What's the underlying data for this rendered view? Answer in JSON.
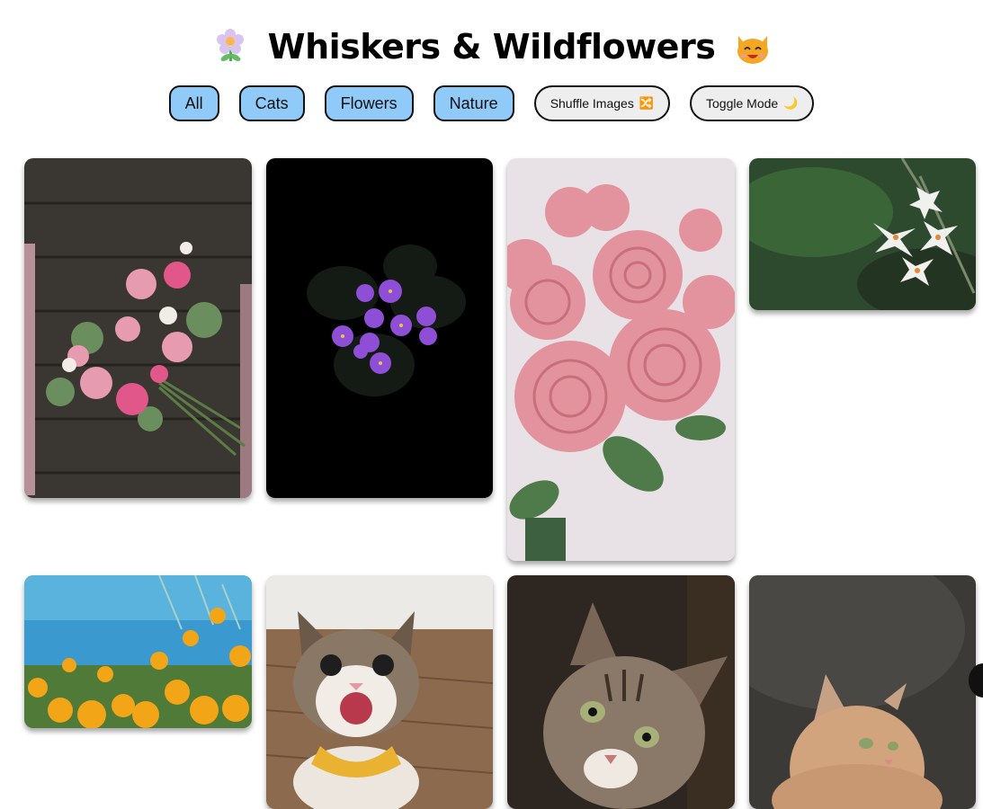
{
  "header": {
    "title": "Whiskers & Wildflowers",
    "icon_left": "flower-icon",
    "icon_right": "cat-icon"
  },
  "filters": {
    "all_label": "All",
    "cats_label": "Cats",
    "flowers_label": "Flowers",
    "nature_label": "Nature",
    "shuffle_label": "Shuffle Images",
    "shuffle_icon": "🔀",
    "toggle_label": "Toggle Mode",
    "toggle_icon": "🌙"
  },
  "colors": {
    "filter_bg": "#90caf9",
    "pill_bg": "#eeeeee",
    "border": "#111111"
  },
  "gallery": {
    "images": [
      {
        "name": "bouquet-on-wood",
        "category": "flowers"
      },
      {
        "name": "violets-dark",
        "category": "flowers"
      },
      {
        "name": "pink-peonies",
        "category": "flowers"
      },
      {
        "name": "white-blossom",
        "category": "nature"
      },
      {
        "name": "orange-poppies",
        "category": "nature"
      },
      {
        "name": "happy-cat-bandana",
        "category": "cats"
      },
      {
        "name": "tabby-cat-closeup",
        "category": "cats"
      },
      {
        "name": "ginger-fluffy-cat",
        "category": "cats"
      }
    ]
  }
}
